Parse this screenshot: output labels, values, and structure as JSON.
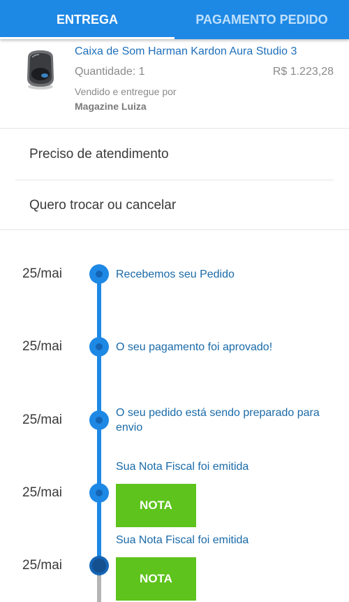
{
  "tabs": [
    {
      "label": "ENTREGA",
      "active": true
    },
    {
      "label": "PAGAMENTO PEDIDO",
      "active": false
    }
  ],
  "product": {
    "name": "Caixa de Som Harman Kardon Aura Studio 3",
    "quantity": "Quantidade: 1",
    "price": "R$ 1.223,28",
    "sold_by_label": "Vendido e entregue por",
    "seller": "Magazine Luiza",
    "image_icon": "speaker-product-image"
  },
  "options": [
    {
      "label": "Preciso de atendimento"
    },
    {
      "label": "Quero trocar ou cancelar"
    }
  ],
  "timeline": [
    {
      "date": "25/mai",
      "text": "Recebemos seu Pedido"
    },
    {
      "date": "25/mai",
      "text": "O seu pagamento foi aprovado!"
    },
    {
      "date": "25/mai",
      "text": "O seu pedido está sendo preparado para envio"
    },
    {
      "date": "25/mai",
      "text": "Sua Nota Fiscal foi emitida",
      "button": "NOTA"
    },
    {
      "date": "25/mai",
      "text": "Sua Nota Fiscal foi emitida",
      "button": "NOTA"
    }
  ],
  "colors": {
    "primary": "#1e88e5",
    "primary_dark": "#1565b5",
    "link_text": "#1e6fba",
    "nota_button": "#5ec31c",
    "line_inactive": "#b5b5b5"
  }
}
